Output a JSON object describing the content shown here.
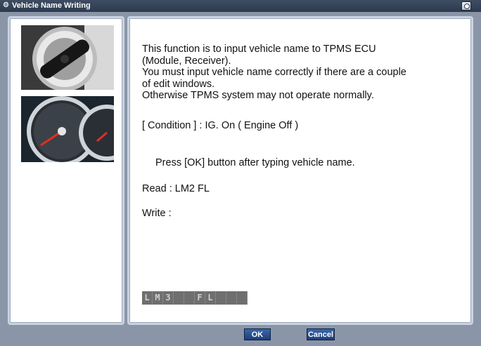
{
  "window": {
    "title": "Vehicle Name Writing"
  },
  "icons": {
    "title_icon": "gear-icon",
    "title_button": "system-menu-icon"
  },
  "images": {
    "ignition": "ignition-key-image",
    "cluster": "instrument-cluster-image"
  },
  "main": {
    "intro_lines": [
      "This function is to input vehicle name to TPMS ECU",
      "(Module, Receiver).",
      "You must input vehicle name correctly if there are a couple",
      "of edit windows.",
      "Otherwise TPMS system may not operate normally."
    ],
    "condition": "[ Condition ] : IG. On ( Engine Off )",
    "instruction": "Press [OK] button after typing vehicle name.",
    "read": "Read : LM2 FL",
    "write_label": "Write :"
  },
  "edit_cells": [
    "L",
    "M",
    "3",
    "",
    "",
    "F",
    "L",
    "",
    "",
    ""
  ],
  "buttons": {
    "ok": "OK",
    "cancel": "Cancel"
  }
}
